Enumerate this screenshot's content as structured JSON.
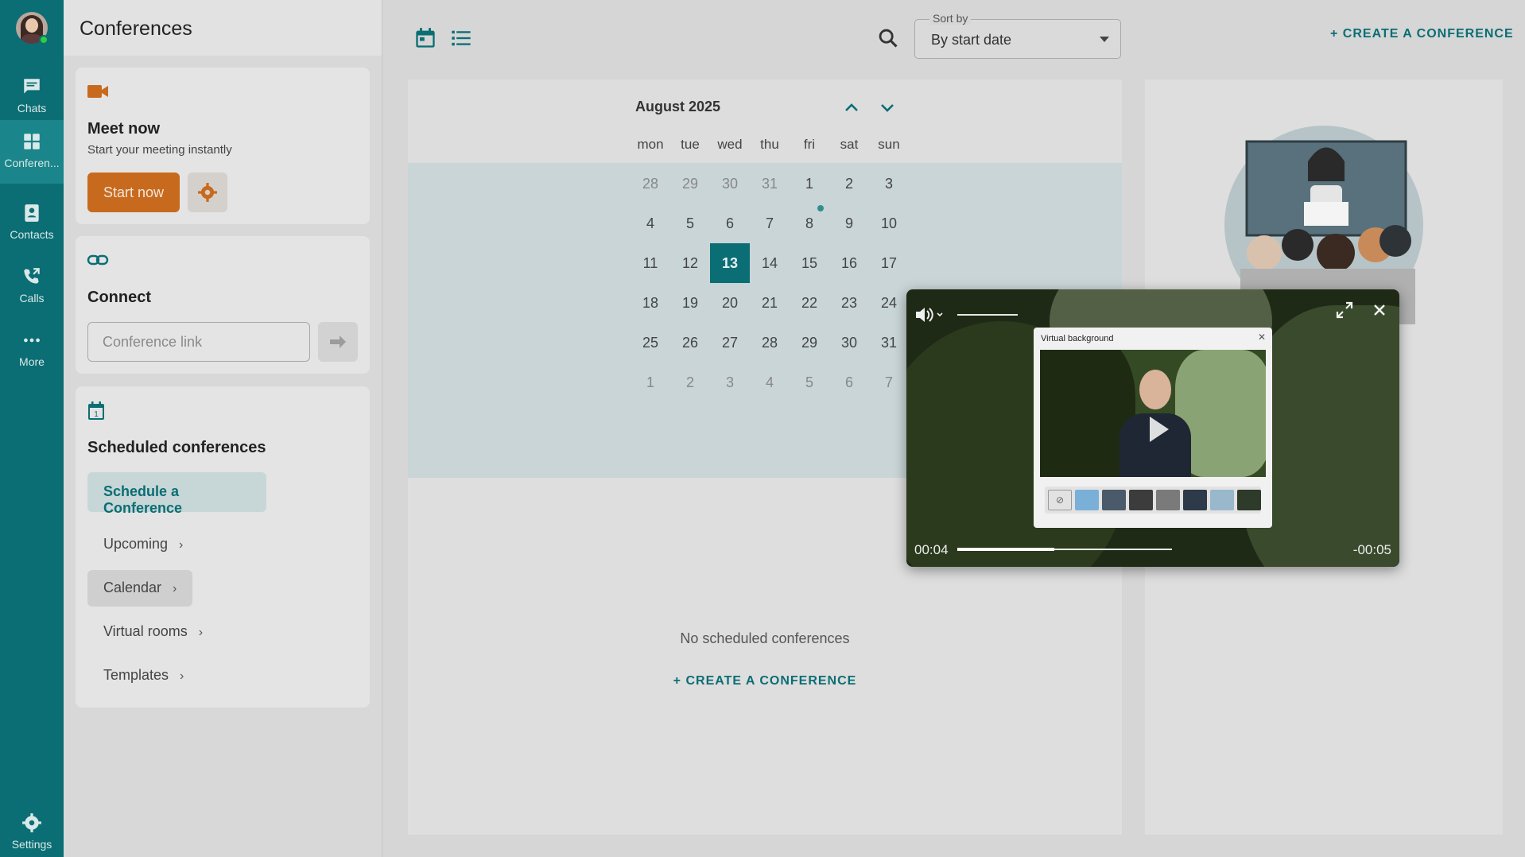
{
  "rail": {
    "items": [
      {
        "label": "Chats",
        "icon": "chat-icon"
      },
      {
        "label": "Conferen...",
        "icon": "conference-icon"
      },
      {
        "label": "Contacts",
        "icon": "contacts-icon"
      },
      {
        "label": "Calls",
        "icon": "calls-icon"
      },
      {
        "label": "More",
        "icon": "more-icon"
      }
    ],
    "settings_label": "Settings"
  },
  "panel": {
    "title": "Conferences",
    "meet_now": {
      "title": "Meet now",
      "subtitle": "Start your meeting instantly",
      "start_label": "Start now"
    },
    "connect": {
      "title": "Connect",
      "placeholder": "Conference link"
    },
    "scheduled": {
      "title": "Scheduled conferences",
      "schedule_label": "Schedule a Conference",
      "links": [
        "Upcoming",
        "Calendar",
        "Virtual rooms",
        "Templates"
      ],
      "active_link": "Calendar"
    }
  },
  "toolbar": {
    "sort_label": "Sort by",
    "sort_value": "By start date",
    "create_label": "+ CREATE A CONFERENCE"
  },
  "calendar": {
    "month": "August 2025",
    "weekdays": [
      "mon",
      "tue",
      "wed",
      "thu",
      "fri",
      "sat",
      "sun"
    ],
    "weeks": [
      [
        "28",
        "29",
        "30",
        "31",
        "1",
        "2",
        "3"
      ],
      [
        "4",
        "5",
        "6",
        "7",
        "8",
        "9",
        "10"
      ],
      [
        "11",
        "12",
        "13",
        "14",
        "15",
        "16",
        "17"
      ],
      [
        "18",
        "19",
        "20",
        "21",
        "22",
        "23",
        "24"
      ],
      [
        "25",
        "26",
        "27",
        "28",
        "29",
        "30",
        "31"
      ],
      [
        "1",
        "2",
        "3",
        "4",
        "5",
        "6",
        "7"
      ]
    ],
    "today": "13",
    "event_day": "8",
    "empty_text": "No scheduled conferences",
    "create_label": "+ CREATE A CONFERENCE"
  },
  "video": {
    "time_elapsed": "00:04",
    "time_remaining": "-00:05",
    "progress_fraction": 0.45,
    "panel_title": "Virtual background",
    "thumb_colors": [
      "#e2e2e2",
      "#7ab0d8",
      "#4a5a6a",
      "#3c3c3c",
      "#7a7a7a",
      "#2c3a4a",
      "#9ab8cc",
      "#2e3a2a"
    ]
  },
  "colors": {
    "accent": "#0a6e74",
    "orange": "#c86a1d"
  }
}
